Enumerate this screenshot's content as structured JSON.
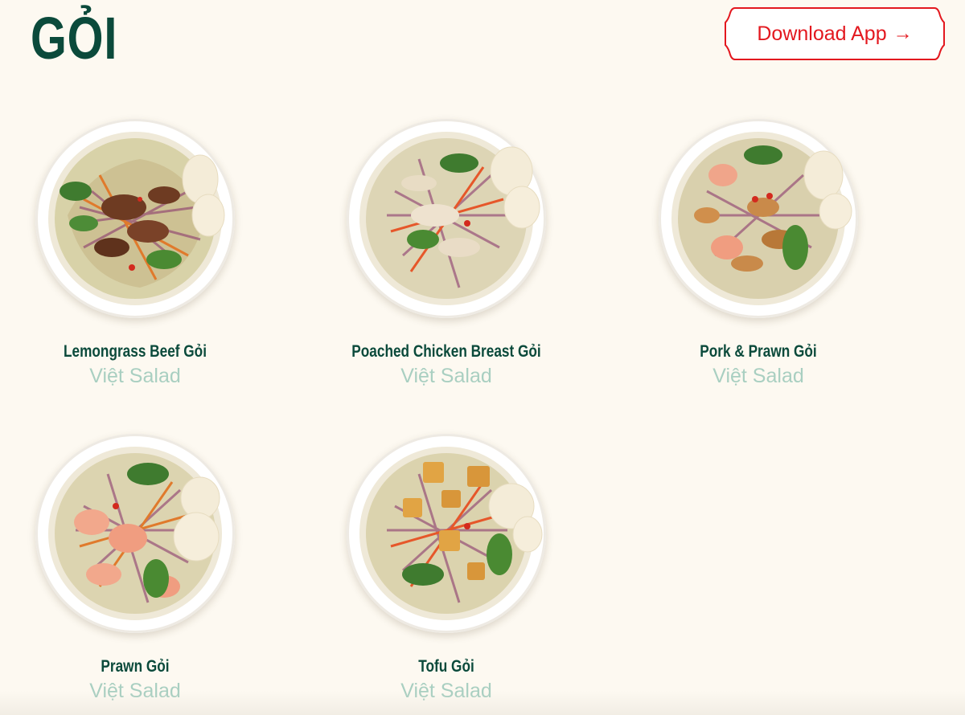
{
  "header": {
    "title": "GỎI",
    "download_button": {
      "label": "Download App",
      "icon": "arrow-right-icon",
      "color": "#e3181f"
    }
  },
  "menu": {
    "items": [
      {
        "name": "Lemongrass Beef Gỏi",
        "subtitle": "Việt Salad",
        "protein": "beef"
      },
      {
        "name": "Poached Chicken Breast Gỏi",
        "subtitle": "Việt Salad",
        "protein": "chicken"
      },
      {
        "name": "Pork & Prawn Gỏi",
        "subtitle": "Việt Salad",
        "protein": "pork-prawn"
      },
      {
        "name": "Prawn Gỏi",
        "subtitle": "Việt Salad",
        "protein": "prawn"
      },
      {
        "name": "Tofu Gỏi",
        "subtitle": "Việt Salad",
        "protein": "tofu"
      }
    ]
  },
  "colors": {
    "background": "#fdf9f1",
    "title": "#0b4a3b",
    "subtitle": "#a9cfc1",
    "accent": "#e3181f"
  }
}
